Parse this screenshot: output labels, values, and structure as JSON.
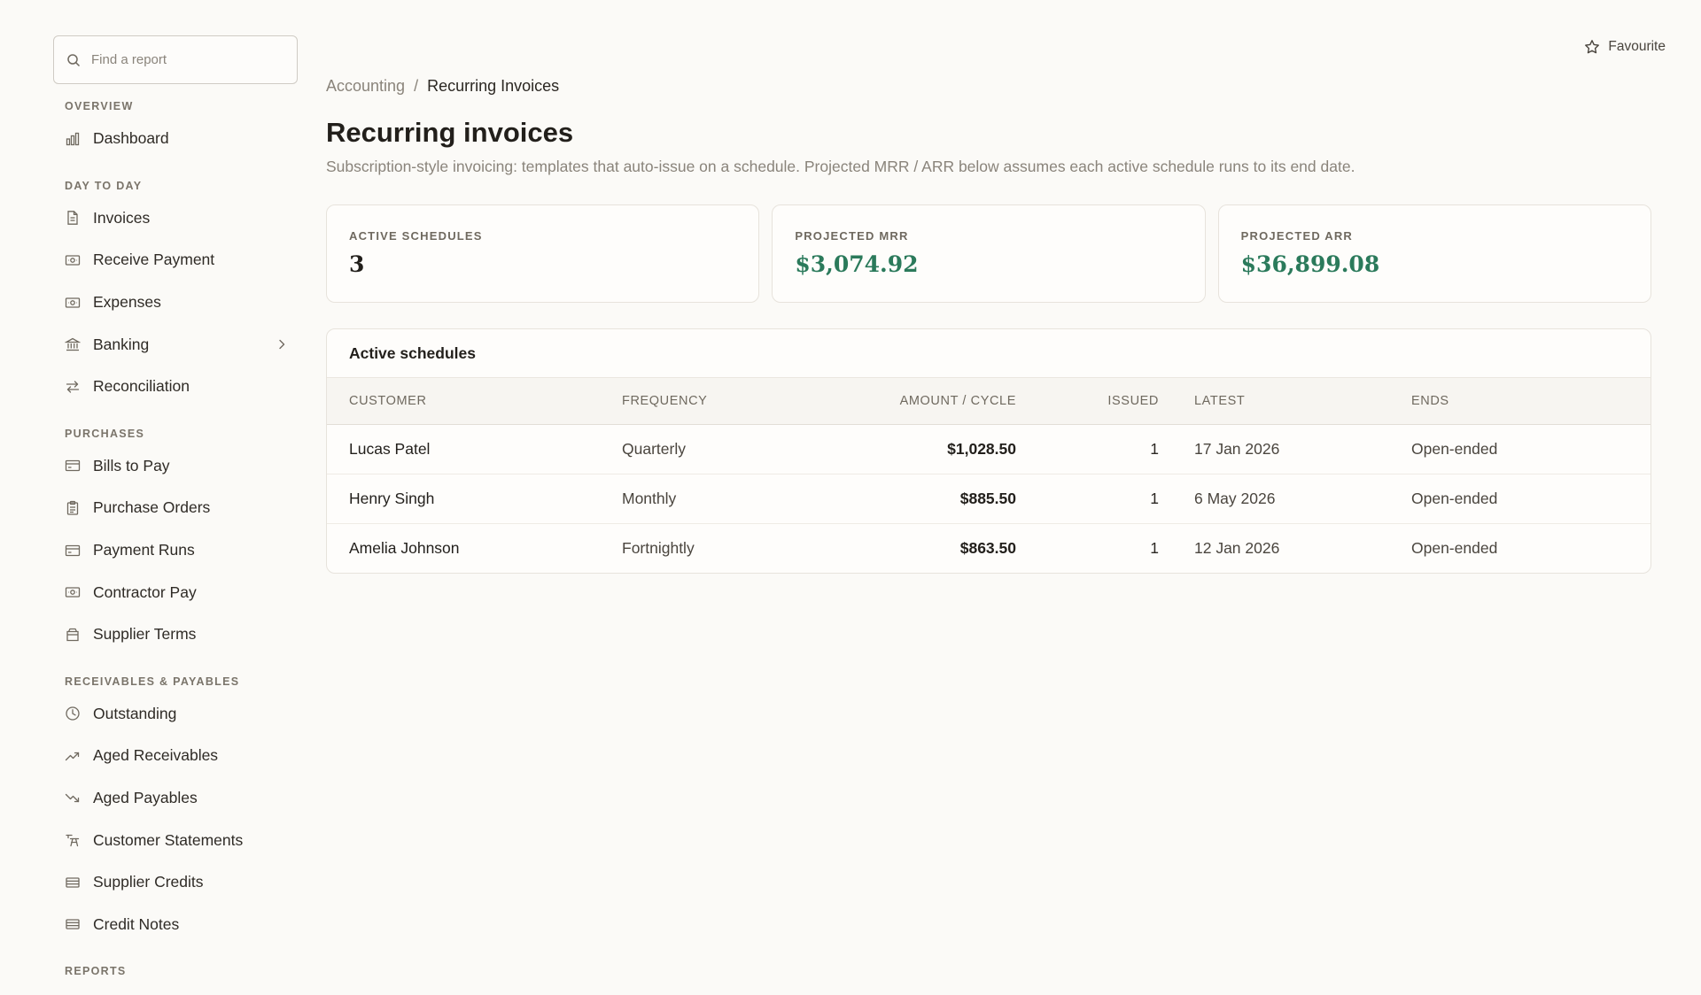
{
  "sidebar": {
    "search_placeholder": "Find a report",
    "sections": [
      {
        "title": "OVERVIEW",
        "items": [
          {
            "label": "Dashboard",
            "icon": "bar-chart-icon"
          }
        ]
      },
      {
        "title": "DAY TO DAY",
        "items": [
          {
            "label": "Invoices",
            "icon": "document-icon"
          },
          {
            "label": "Receive Payment",
            "icon": "banknote-icon"
          },
          {
            "label": "Expenses",
            "icon": "banknote-icon"
          },
          {
            "label": "Banking",
            "icon": "bank-icon",
            "has_chevron": true
          },
          {
            "label": "Reconciliation",
            "icon": "arrows-swap-icon"
          }
        ]
      },
      {
        "title": "PURCHASES",
        "items": [
          {
            "label": "Bills to Pay",
            "icon": "credit-card-icon"
          },
          {
            "label": "Purchase Orders",
            "icon": "clipboard-icon"
          },
          {
            "label": "Payment Runs",
            "icon": "credit-card-icon"
          },
          {
            "label": "Contractor Pay",
            "icon": "banknote-icon"
          },
          {
            "label": "Supplier Terms",
            "icon": "wallet-icon"
          }
        ]
      },
      {
        "title": "RECEIVABLES & PAYABLES",
        "items": [
          {
            "label": "Outstanding",
            "icon": "clock-icon"
          },
          {
            "label": "Aged Receivables",
            "icon": "trend-up-icon"
          },
          {
            "label": "Aged Payables",
            "icon": "trend-down-icon"
          },
          {
            "label": "Customer Statements",
            "icon": "statement-icon"
          },
          {
            "label": "Supplier Credits",
            "icon": "stack-icon"
          },
          {
            "label": "Credit Notes",
            "icon": "stack-icon"
          }
        ]
      },
      {
        "title": "REPORTS",
        "items": []
      }
    ]
  },
  "header": {
    "favourite_label": "Favourite",
    "breadcrumb": {
      "parent": "Accounting",
      "separator": "/",
      "current": "Recurring Invoices"
    },
    "title": "Recurring invoices",
    "description": "Subscription-style invoicing: templates that auto-issue on a schedule. Projected MRR / ARR below assumes each active schedule runs to its end date."
  },
  "stats": [
    {
      "label": "ACTIVE SCHEDULES",
      "value": "3",
      "money": false
    },
    {
      "label": "PROJECTED MRR",
      "value": "$3,074.92",
      "money": true
    },
    {
      "label": "PROJECTED ARR",
      "value": "$36,899.08",
      "money": true
    }
  ],
  "schedules": {
    "title": "Active schedules",
    "columns": {
      "customer": "CUSTOMER",
      "frequency": "FREQUENCY",
      "amount": "AMOUNT / CYCLE",
      "issued": "ISSUED",
      "latest": "LATEST",
      "ends": "ENDS"
    },
    "rows": [
      {
        "customer": "Lucas Patel",
        "frequency": "Quarterly",
        "amount": "$1,028.50",
        "issued": "1",
        "latest": "17 Jan 2026",
        "ends": "Open-ended"
      },
      {
        "customer": "Henry Singh",
        "frequency": "Monthly",
        "amount": "$885.50",
        "issued": "1",
        "latest": "6 May 2026",
        "ends": "Open-ended"
      },
      {
        "customer": "Amelia Johnson",
        "frequency": "Fortnightly",
        "amount": "$863.50",
        "issued": "1",
        "latest": "12 Jan 2026",
        "ends": "Open-ended"
      }
    ]
  },
  "colors": {
    "accent_money": "#2b7a5b",
    "background": "#fbfaf7"
  }
}
